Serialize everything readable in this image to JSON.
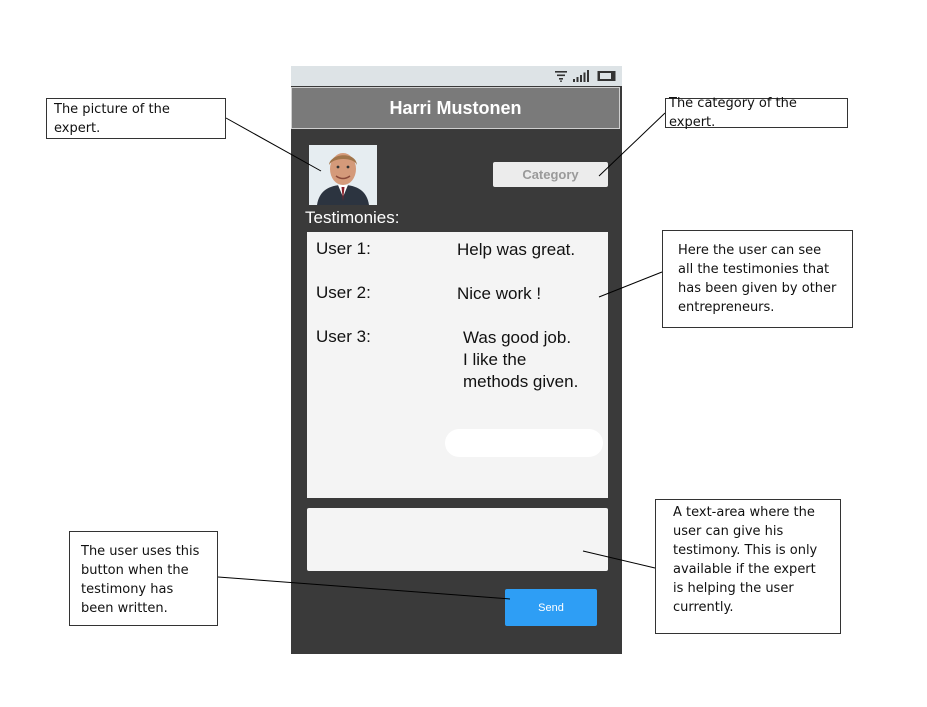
{
  "phone": {
    "title": "Harri Mustonen",
    "category_label": "Category",
    "testimonies_heading": "Testimonies:",
    "testimonies": [
      {
        "user": "User 1:",
        "text": "Help was great."
      },
      {
        "user": "User 2:",
        "text": "Nice work !"
      },
      {
        "user": "User 3:",
        "text": "Was good job.\nI like the\nmethods given."
      }
    ],
    "send_label": "Send",
    "status_icons": [
      "wifi-icon",
      "signal-icon",
      "battery-icon"
    ],
    "colors": {
      "screen_bg": "#3a3a3a",
      "title_bar": "#7a7a7a",
      "status_bar": "#dde3e6",
      "send_button": "#2e9ef5",
      "panel": "#f4f4f4"
    }
  },
  "annotations": {
    "picture": "The picture of the expert.",
    "category": "The category of the expert.",
    "testimonies": "Here the user can see all the testimonies that has been given by other entrepreneurs.",
    "textarea": "A text-area where the user can give his testimony. This is only available if the expert is helping the user currently.",
    "send": "The user uses this button when the testimony has been written."
  }
}
